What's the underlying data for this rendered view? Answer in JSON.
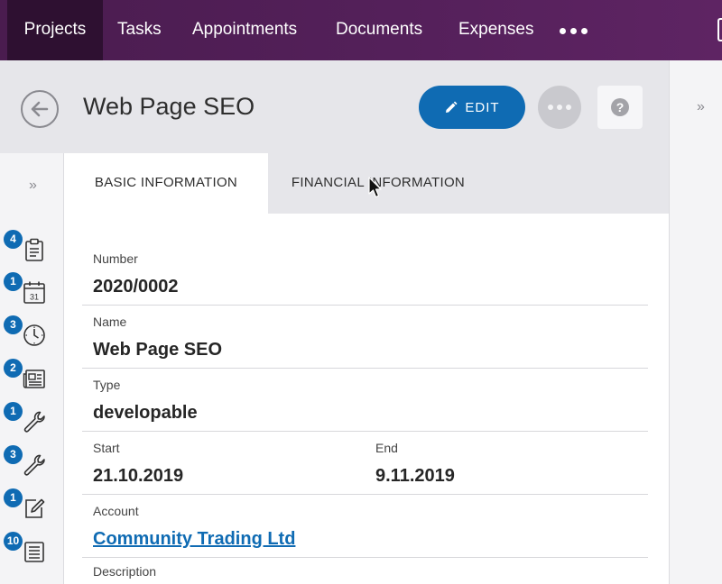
{
  "nav": {
    "items": [
      "Projects",
      "Tasks",
      "Appointments",
      "Documents",
      "Expenses"
    ],
    "more_icon": "more-horizontal-icon"
  },
  "header": {
    "title": "Web Page SEO",
    "edit_label": "EDIT",
    "edit_icon": "pencil-icon",
    "back_icon": "arrow-left-icon",
    "help_label": "?"
  },
  "tabs": [
    "BASIC INFORMATION",
    "FINANCIAL INFORMATION"
  ],
  "sidebar": {
    "items": [
      {
        "icon": "clipboard-icon",
        "badge": "4"
      },
      {
        "icon": "calendar-icon",
        "badge": "1",
        "icon_text": "31"
      },
      {
        "icon": "clock-icon",
        "badge": "3"
      },
      {
        "icon": "newspaper-icon",
        "badge": "2"
      },
      {
        "icon": "wrench-icon",
        "badge": "1"
      },
      {
        "icon": "wrench-icon",
        "badge": "3"
      },
      {
        "icon": "edit-document-icon",
        "badge": "1"
      },
      {
        "icon": "document-list-icon",
        "badge": "10"
      }
    ]
  },
  "fields": {
    "number": {
      "label": "Number",
      "value": "2020/0002"
    },
    "name": {
      "label": "Name",
      "value": "Web Page SEO"
    },
    "type": {
      "label": "Type",
      "value": "developable"
    },
    "start": {
      "label": "Start",
      "value": "21.10.2019"
    },
    "end": {
      "label": "End",
      "value": "9.11.2019"
    },
    "account": {
      "label": "Account",
      "value": "Community Trading Ltd"
    },
    "description": {
      "label": "Description"
    }
  },
  "colors": {
    "nav_bg": "#54205a",
    "nav_active": "#2e1031",
    "accent": "#0f6bb3"
  }
}
